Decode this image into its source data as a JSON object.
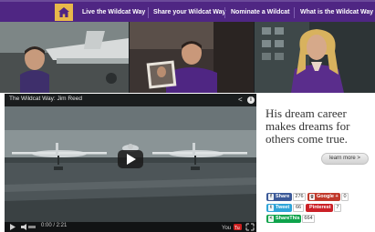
{
  "nav": {
    "items": [
      {
        "label": "Live the Wildcat Way"
      },
      {
        "label": "Share your Wildcat Way"
      },
      {
        "label": "Nominate a Wildcat"
      },
      {
        "label": "What is the Wildcat Way"
      }
    ],
    "home_icon": "home-icon"
  },
  "video": {
    "title": "The Wildcat Way: Jim Reed",
    "time": "0:00 / 2:21",
    "share_icon": "share-icon",
    "info_label": "i",
    "play_icon": "play-icon",
    "brand": "YouTube"
  },
  "tagline": "His dream career makes dreams for others come true.",
  "learn_more": "learn more >",
  "social": {
    "facebook": {
      "label": "Share",
      "count": "276"
    },
    "google": {
      "label": "Google +",
      "count": "0"
    },
    "twitter": {
      "label": "Tweet",
      "count": "66"
    },
    "pinterest": {
      "label": "Pinterest",
      "count": "7"
    },
    "sharethis": {
      "label": "ShareThis",
      "count": "664"
    }
  },
  "colors": {
    "nav_purple": "#4f2683",
    "accent_gold": "#e8b84a"
  }
}
